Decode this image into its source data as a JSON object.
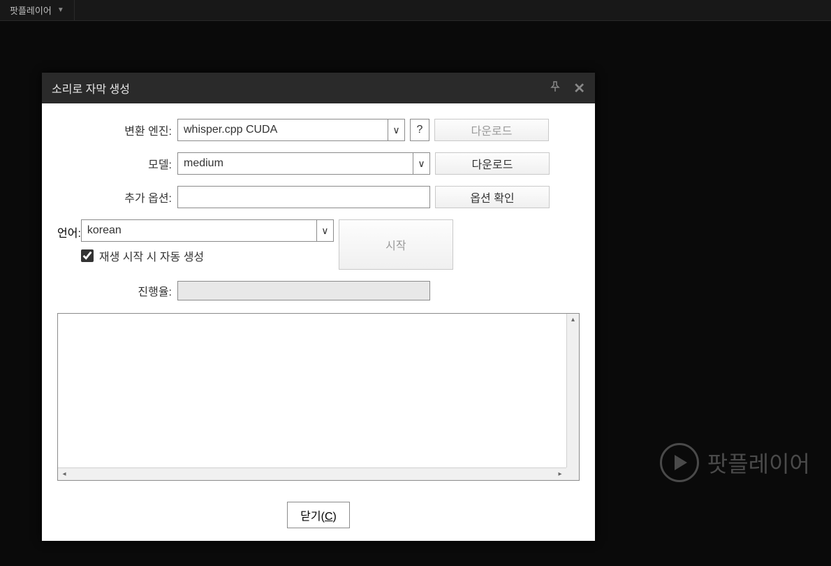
{
  "app": {
    "title": "팟플레이어",
    "watermark": "팟플레이어"
  },
  "dialog": {
    "title": "소리로 자막 생성",
    "labels": {
      "engine": "변환 엔진:",
      "model": "모델:",
      "options": "추가 옵션:",
      "language": "언어:",
      "progress": "진행율:"
    },
    "fields": {
      "engine_value": "whisper.cpp CUDA",
      "model_value": "medium",
      "options_value": "",
      "language_value": "korean",
      "auto_generate_label": "재생 시작 시 자동 생성",
      "auto_generate_checked": true
    },
    "buttons": {
      "help": "?",
      "download1": "다운로드",
      "download2": "다운로드",
      "check_options": "옵션 확인",
      "start": "시작",
      "close_prefix": "닫기(",
      "close_key": "C",
      "close_suffix": ")"
    }
  }
}
